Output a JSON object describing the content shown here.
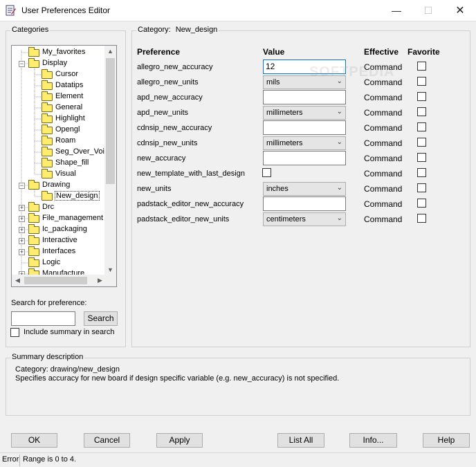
{
  "window": {
    "title": "User Preferences Editor",
    "minimize_icon": "minimize-icon",
    "maximize_icon": "maximize-icon",
    "close_icon": "close-icon"
  },
  "categories": {
    "label": "Categories",
    "tree": [
      {
        "label": "My_favorites",
        "level": 0,
        "expander": "none",
        "selected": false
      },
      {
        "label": "Display",
        "level": 0,
        "expander": "minus",
        "selected": false
      },
      {
        "label": "Cursor",
        "level": 1,
        "expander": "none",
        "selected": false
      },
      {
        "label": "Datatips",
        "level": 1,
        "expander": "none",
        "selected": false
      },
      {
        "label": "Element",
        "level": 1,
        "expander": "none",
        "selected": false
      },
      {
        "label": "General",
        "level": 1,
        "expander": "none",
        "selected": false
      },
      {
        "label": "Highlight",
        "level": 1,
        "expander": "none",
        "selected": false
      },
      {
        "label": "Opengl",
        "level": 1,
        "expander": "none",
        "selected": false
      },
      {
        "label": "Roam",
        "level": 1,
        "expander": "none",
        "selected": false
      },
      {
        "label": "Seg_Over_Voi",
        "level": 1,
        "expander": "none",
        "selected": false
      },
      {
        "label": "Shape_fill",
        "level": 1,
        "expander": "none",
        "selected": false
      },
      {
        "label": "Visual",
        "level": 1,
        "expander": "none",
        "selected": false
      },
      {
        "label": "Drawing",
        "level": 0,
        "expander": "minus",
        "selected": false
      },
      {
        "label": "New_design",
        "level": 1,
        "expander": "none",
        "selected": true
      },
      {
        "label": "Drc",
        "level": 0,
        "expander": "plus",
        "selected": false
      },
      {
        "label": "File_management",
        "level": 0,
        "expander": "plus",
        "selected": false
      },
      {
        "label": "Ic_packaging",
        "level": 0,
        "expander": "plus",
        "selected": false
      },
      {
        "label": "Interactive",
        "level": 0,
        "expander": "plus",
        "selected": false
      },
      {
        "label": "Interfaces",
        "level": 0,
        "expander": "plus",
        "selected": false
      },
      {
        "label": "Logic",
        "level": 0,
        "expander": "none",
        "selected": false
      },
      {
        "label": "Manufacture",
        "level": 0,
        "expander": "plus",
        "selected": false
      }
    ]
  },
  "search": {
    "label": "Search for preference:",
    "value": "",
    "button_label": "Search",
    "include_summary_label": "Include summary in search",
    "include_summary_checked": false
  },
  "category_panel": {
    "prefix": "Category:",
    "name": "New_design"
  },
  "columns": {
    "preference": "Preference",
    "value": "Value",
    "effective": "Effective",
    "favorite": "Favorite"
  },
  "watermark": "SOFTPEDIA",
  "preferences": [
    {
      "name": "allegro_new_accuracy",
      "type": "text",
      "value": "12",
      "effective": "Command",
      "favorite": false
    },
    {
      "name": "allegro_new_units",
      "type": "select",
      "value": "mils",
      "effective": "Command",
      "favorite": false
    },
    {
      "name": "apd_new_accuracy",
      "type": "text",
      "value": "",
      "effective": "Command",
      "favorite": false
    },
    {
      "name": "apd_new_units",
      "type": "select",
      "value": "millimeters",
      "effective": "Command",
      "favorite": false
    },
    {
      "name": "cdnsip_new_accuracy",
      "type": "text",
      "value": "",
      "effective": "Command",
      "favorite": false
    },
    {
      "name": "cdnsip_new_units",
      "type": "select",
      "value": "millimeters",
      "effective": "Command",
      "favorite": false
    },
    {
      "name": "new_accuracy",
      "type": "text",
      "value": "",
      "effective": "Command",
      "favorite": false
    },
    {
      "name": "new_template_with_last_design",
      "type": "checkbox",
      "value": false,
      "effective": "Command",
      "favorite": false
    },
    {
      "name": "new_units",
      "type": "select",
      "value": "inches",
      "effective": "Command",
      "favorite": false
    },
    {
      "name": "padstack_editor_new_accuracy",
      "type": "text",
      "value": "",
      "effective": "Command",
      "favorite": false
    },
    {
      "name": "padstack_editor_new_units",
      "type": "select",
      "value": "centimeters",
      "effective": "Command",
      "favorite": false
    }
  ],
  "summary": {
    "label": "Summary description",
    "line1": "Category: drawing/new_design",
    "line2": "Specifies accuracy for new board if design specific variable (e.g. new_accuracy) is not specified."
  },
  "buttons": {
    "ok": "OK",
    "cancel": "Cancel",
    "apply": "Apply",
    "list_all": "List All",
    "info": "Info...",
    "help": "Help"
  },
  "status": {
    "type": "Error",
    "message": "Range is 0 to 4."
  }
}
